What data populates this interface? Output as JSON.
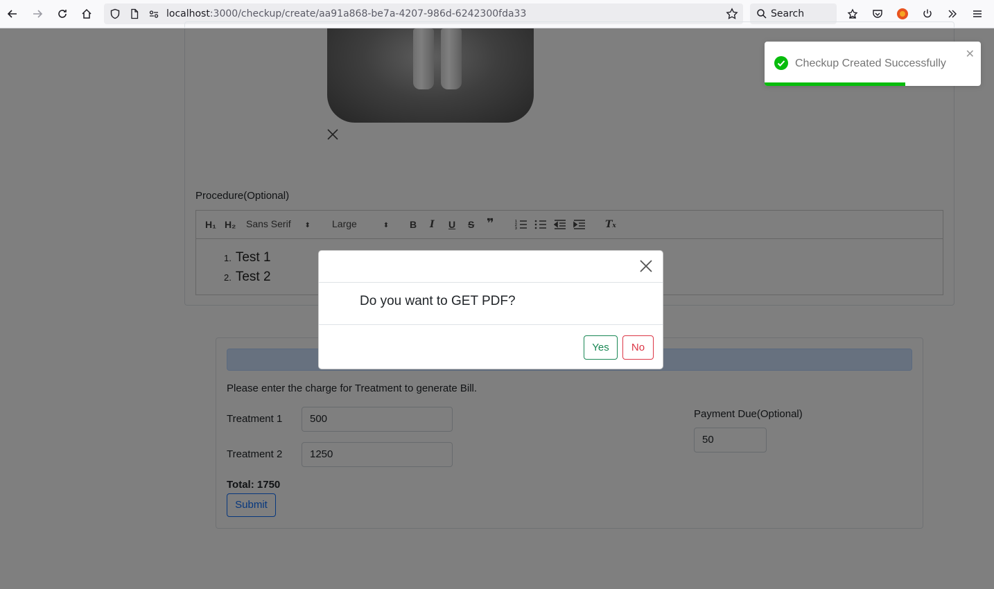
{
  "browser": {
    "url_host": "localhost",
    "url_path": ":3000/checkup/create/aa91a868-be7a-4207-986d-6242300fda33",
    "search_placeholder": "Search"
  },
  "procedure": {
    "label": "Procedure(Optional)",
    "toolbar": {
      "h1": "H₁",
      "h2": "H₂",
      "font_family": "Sans Serif",
      "font_size": "Large"
    },
    "items": [
      {
        "num": "1.",
        "text": "Test 1"
      },
      {
        "num": "2.",
        "text": "Test 2"
      }
    ]
  },
  "bill": {
    "note": "Please enter the charge for Treatment to generate Bill.",
    "treatment1_label": "Treatment 1",
    "treatment1_value": "500",
    "treatment2_label": "Treatment 2",
    "treatment2_value": "1250",
    "payment_due_label": "Payment Due(Optional)",
    "payment_due_value": "50",
    "total": "Total: 1750",
    "submit_label": "Submit"
  },
  "modal": {
    "question": "Do you want to GET PDF?",
    "yes_label": "Yes",
    "no_label": "No"
  },
  "toast": {
    "message": "Checkup Created Successfully",
    "progress": 0.65,
    "color": "#07bc0c"
  }
}
